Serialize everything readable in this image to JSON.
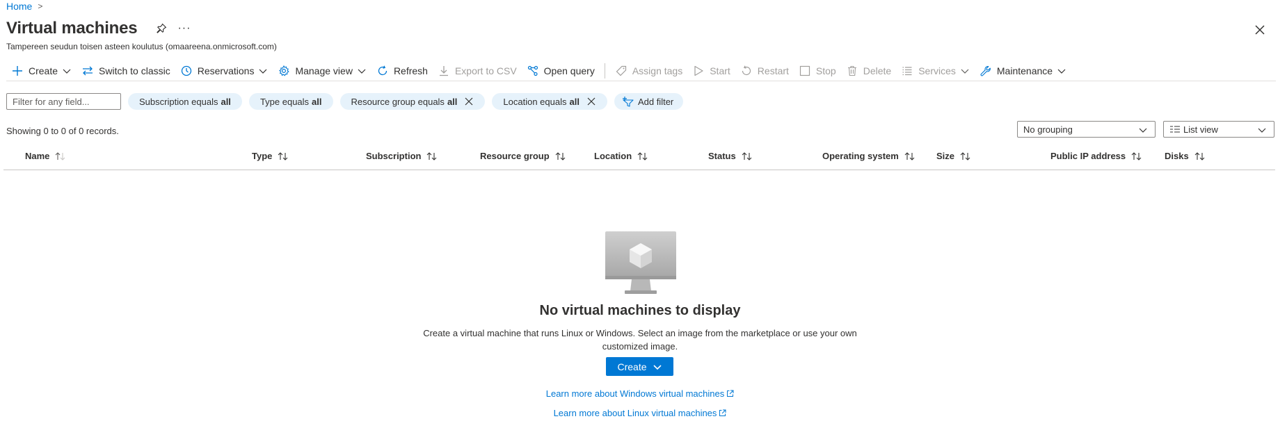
{
  "breadcrumb": {
    "home": "Home",
    "separator": ">"
  },
  "header": {
    "title": "Virtual machines",
    "more": "···",
    "subtitle": "Tampereen seudun toisen asteen koulutus (omaareena.onmicrosoft.com)",
    "icons": {
      "pin": "pin-icon",
      "close": "close-icon"
    }
  },
  "toolbar": {
    "create": "Create",
    "switch_classic": "Switch to classic",
    "reservations": "Reservations",
    "manage_view": "Manage view",
    "refresh": "Refresh",
    "export_csv": "Export to CSV",
    "open_query": "Open query",
    "assign_tags": "Assign tags",
    "start": "Start",
    "restart": "Restart",
    "stop": "Stop",
    "delete": "Delete",
    "services": "Services",
    "maintenance": "Maintenance"
  },
  "filters": {
    "placeholder": "Filter for any field...",
    "pills": [
      {
        "label": "Subscription equals",
        "value": "all"
      },
      {
        "label": "Type equals",
        "value": "all"
      },
      {
        "label": "Resource group equals",
        "value": "all"
      },
      {
        "label": "Location equals",
        "value": "all"
      }
    ],
    "add_filter": "Add filter"
  },
  "records": "Showing 0 to 0 of 0 records.",
  "grouping": "No grouping",
  "view": "List view",
  "columns": [
    "Name",
    "Type",
    "Subscription",
    "Resource group",
    "Location",
    "Status",
    "Operating system",
    "Size",
    "Public IP address",
    "Disks"
  ],
  "empty": {
    "title": "No virtual machines to display",
    "description": "Create a virtual machine that runs Linux or Windows. Select an image from the marketplace or use your own customized image.",
    "create": "Create",
    "learn_windows": "Learn more about Windows virtual machines",
    "learn_linux": "Learn more about Linux virtual machines"
  },
  "colors": {
    "accent": "#0078d4",
    "pill_bg": "#e6f2fb",
    "disabled": "#a19f9d",
    "text": "#323130"
  }
}
